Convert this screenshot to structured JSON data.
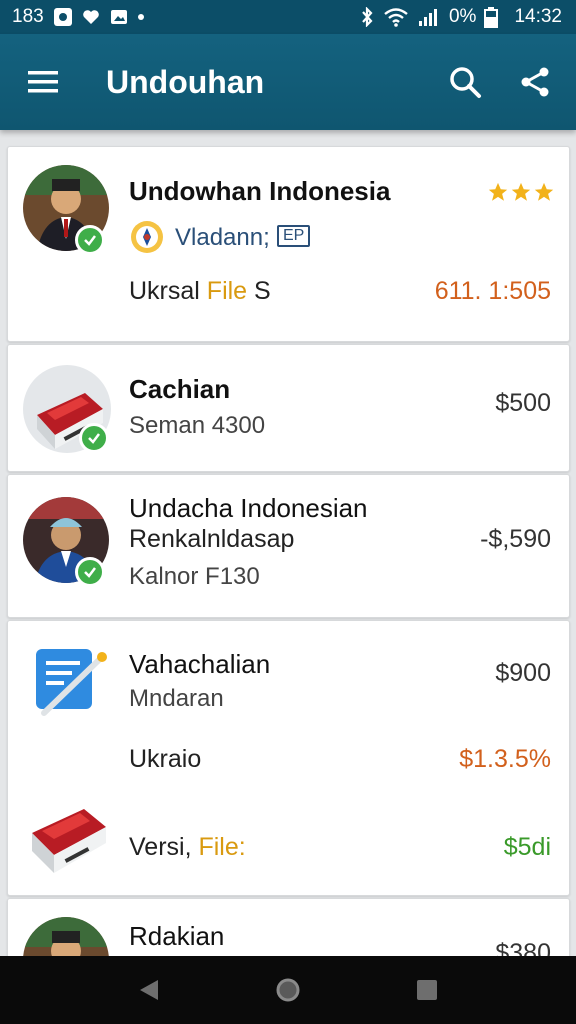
{
  "status_bar": {
    "left_text": "183",
    "battery_text": "0%",
    "time": "14:32"
  },
  "app_bar": {
    "title": "Undouhan"
  },
  "items": [
    {
      "title": "Undowhan Indonesia",
      "subtitle": "Vladann;",
      "tag": "EP",
      "file_prefix": "Ukrsal",
      "file_label": "File",
      "file_suffix": "S",
      "price": "611. 1:505",
      "rating": 3
    },
    {
      "title": "Cachian",
      "subtitle": "Seman 4300",
      "price": "$500"
    },
    {
      "title": "Undacha Indonesian",
      "subtitle": "Renkalnldasap",
      "detail": "Kalnor F130",
      "price": "-$,590"
    },
    {
      "title": "Vahachalian",
      "subtitle": "Mndaran",
      "price": "$900",
      "line2_label": "Ukraio",
      "line2_value": "$1.3.5%",
      "line3_prefix": "Versi,",
      "line3_label": "File:",
      "line3_value": "$5di"
    },
    {
      "title": "Rdakian",
      "price": "$380"
    }
  ],
  "colors": {
    "app_bar": "#0f5670",
    "accent_orange": "#d2601c",
    "accent_green": "#3a9a2a",
    "star": "#f2b21a"
  }
}
